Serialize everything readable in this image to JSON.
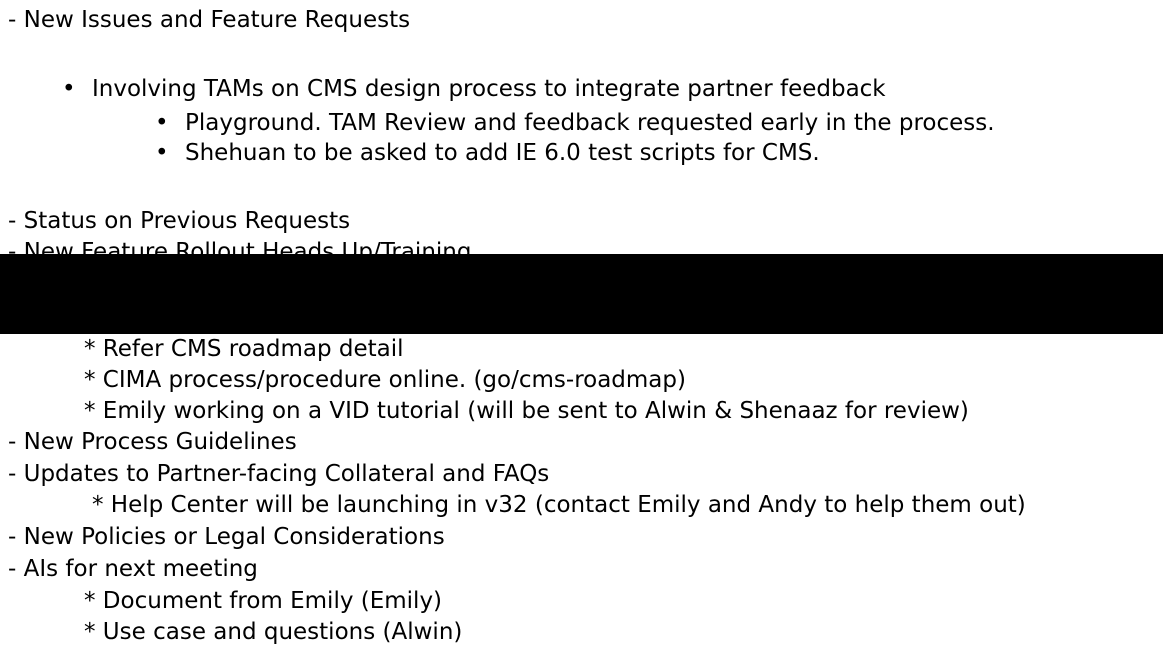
{
  "doc": {
    "section1": {
      "heading": "- New Issues and Feature Requests",
      "items": [
        {
          "bullet": "•",
          "text": "Involving TAMs on CMS design process to integrate partner feedback",
          "sub": [
            {
              "bullet": "•",
              "text": "Playground. TAM Review and feedback requested early in the process."
            },
            {
              "bullet": "•",
              "text": "Shehuan to be asked to add IE 6.0 test scripts for CMS."
            }
          ]
        }
      ]
    },
    "section2": {
      "heading": "- Status on Previous Requests"
    },
    "section3": {
      "heading": "- New Feature Rollout Heads Up/Training"
    },
    "rollout_items": [
      "* Refer CMS roadmap detail",
      "* CIMA process/procedure online. (go/cms-roadmap)",
      "* Emily working on a VID tutorial (will be sent to Alwin & Shenaaz for review)"
    ],
    "section4": {
      "heading": "- New Process Guidelines"
    },
    "section5": {
      "heading": "- Updates to Partner-facing Collateral and FAQs",
      "items": [
        "* Help Center will be launching in v32 (contact Emily and Andy to help them out)"
      ]
    },
    "section6": {
      "heading": "- New Policies or Legal Considerations"
    },
    "section7": {
      "heading": "- AIs for next meeting",
      "items": [
        "* Document from Emily (Emily)",
        "* Use case and questions (Alwin)"
      ]
    }
  },
  "colors": {
    "text": "#000000",
    "background": "#ffffff",
    "redaction": "#000000"
  }
}
